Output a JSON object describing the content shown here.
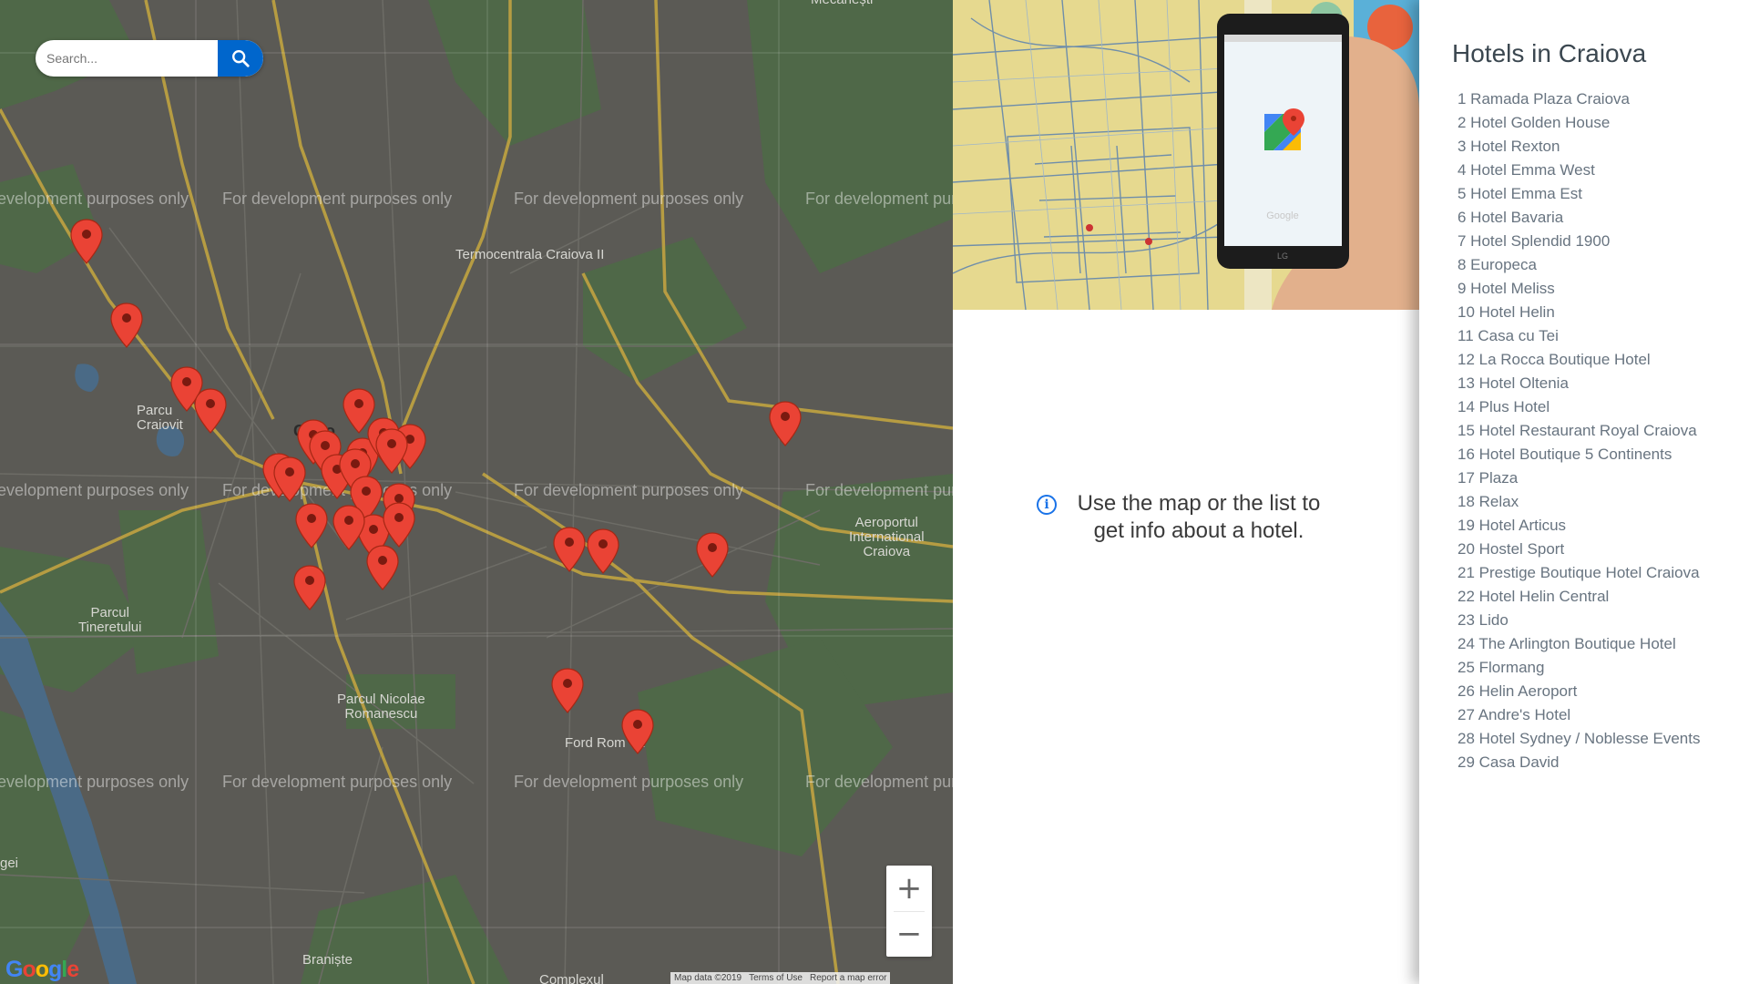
{
  "map": {
    "search": {
      "placeholder": "Search..."
    },
    "watermark": "For development purposes only",
    "labels": {
      "termocentrala": "Termocentrala Craiova II",
      "parcul_craiovita": "Parcu\nCraiovit",
      "craiova": "Craio",
      "aeroport": "Aeroportul\nInternational\nCraiova",
      "parcul_tineretului": "Parcul\nTineretului",
      "parcul_romanescu": "Parcul Nicolae\nRomanescu",
      "ford": "Ford Rom   a",
      "braniste": "Braniște",
      "complexul": "Complexul",
      "mecanesti": "Mecanești",
      "gei": "gei"
    },
    "zoom_in": "+",
    "zoom_out": "−",
    "google_logo": "Google",
    "footer": {
      "map_data": "Map data ©2019",
      "terms": "Terms of Use",
      "report": "Report a map error"
    },
    "marker_icon": "map-pin-icon",
    "marker_color": "#ea4335"
  },
  "info": {
    "message": "Use the map or the list to get info about a hotel.",
    "info_icon": "info-circle-icon"
  },
  "list": {
    "title": "Hotels in Craiova",
    "hotels": [
      "1 Ramada Plaza Craiova",
      "2 Hotel Golden House",
      "3 Hotel Rexton",
      "4 Hotel Emma West",
      "5 Hotel Emma Est",
      "6 Hotel Bavaria",
      "7 Hotel Splendid 1900",
      "8 Europeca",
      "9 Hotel Meliss",
      "10 Hotel Helin",
      "11 Casa cu Tei",
      "12 La Rocca Boutique Hotel",
      "13 Hotel Oltenia",
      "14 Plus Hotel",
      "15 Hotel Restaurant Royal Craiova",
      "16 Hotel Boutique 5 Continents",
      "17 Plaza",
      "18 Relax",
      "19 Hotel Articus",
      "20 Hostel Sport",
      "21 Prestige Boutique Hotel Craiova",
      "22 Hotel Helin Central",
      "23 Lido",
      "24 The Arlington Boutique Hotel",
      "25 Flormang",
      "26 Helin Aeroport",
      "27 Andre's Hotel",
      "28 Hotel Sydney / Noblesse Events",
      "29 Casa David"
    ]
  },
  "colors": {
    "accent": "#0066cc",
    "map_bg": "#5b5a55",
    "map_green": "#4f6848",
    "road_major": "#b69c42",
    "text_list": "#687480"
  }
}
